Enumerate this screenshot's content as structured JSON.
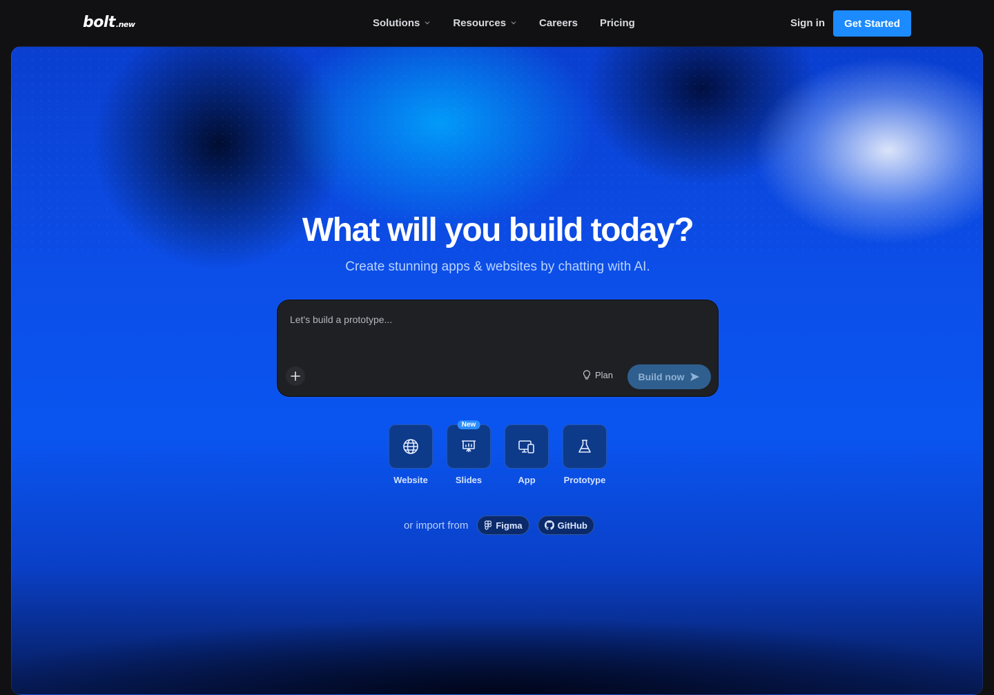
{
  "nav": {
    "logo_main": "bolt",
    "logo_tld": ".new",
    "links": [
      {
        "label": "Solutions",
        "dropdown": true
      },
      {
        "label": "Resources",
        "dropdown": true
      },
      {
        "label": "Careers",
        "dropdown": false
      },
      {
        "label": "Pricing",
        "dropdown": false
      }
    ],
    "sign_in": "Sign in",
    "get_started": "Get Started"
  },
  "hero": {
    "title": "What will you build today?",
    "subtitle": "Create stunning apps & websites by chatting with AI."
  },
  "prompt": {
    "placeholder": "Let's build a prototype...",
    "plan_label": "Plan",
    "build_label": "Build now"
  },
  "tiles": [
    {
      "label": "Website",
      "icon": "globe-icon"
    },
    {
      "label": "Slides",
      "icon": "presentation-icon",
      "badge": "New"
    },
    {
      "label": "App",
      "icon": "devices-icon"
    },
    {
      "label": "Prototype",
      "icon": "flask-icon"
    }
  ],
  "import": {
    "text": "or import from",
    "figma": "Figma",
    "github": "GitHub"
  },
  "colors": {
    "accent": "#1c8bff",
    "background": "#111113",
    "prompt_bg": "#1f2024"
  }
}
